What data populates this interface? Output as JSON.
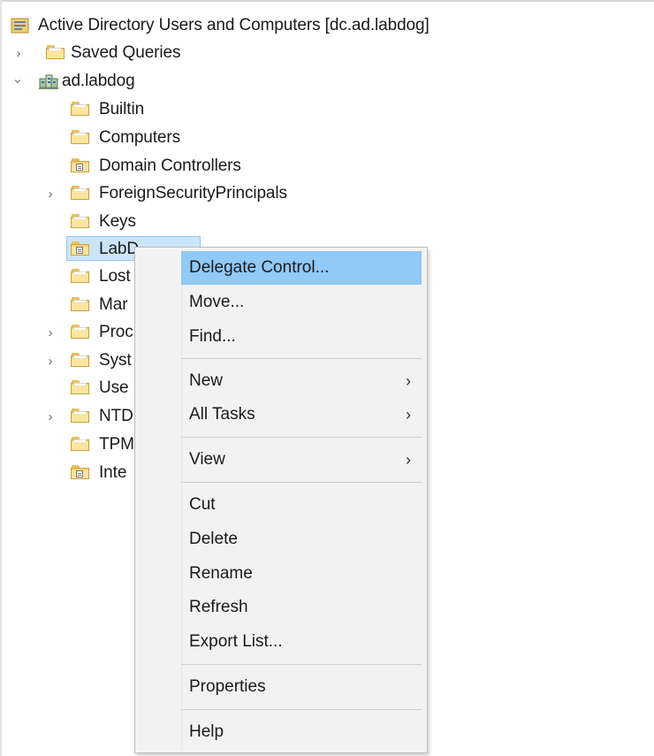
{
  "tree": {
    "root_label": "Active Directory Users and Computers [dc.ad.labdog]",
    "saved_queries_label": "Saved Queries",
    "domain_label": "ad.labdog",
    "items": [
      {
        "label": "Builtin"
      },
      {
        "label": "Computers"
      },
      {
        "label": "Domain Controllers"
      },
      {
        "label": "ForeignSecurityPrincipals"
      },
      {
        "label": "Keys"
      },
      {
        "label": "LabD"
      },
      {
        "label": "Lost"
      },
      {
        "label": "Mar"
      },
      {
        "label": "Proc"
      },
      {
        "label": "Syst"
      },
      {
        "label": "Use"
      },
      {
        "label": "NTD"
      },
      {
        "label": "TPM"
      },
      {
        "label": "Inte"
      }
    ]
  },
  "context_menu": {
    "delegate_control": "Delegate Control...",
    "move": "Move...",
    "find": "Find...",
    "new": "New",
    "all_tasks": "All Tasks",
    "view": "View",
    "cut": "Cut",
    "delete": "Delete",
    "rename": "Rename",
    "refresh": "Refresh",
    "export_list": "Export List...",
    "properties": "Properties",
    "help": "Help"
  },
  "colors": {
    "menu_highlight": "#91c9f7",
    "tree_selection": "#cce4f7",
    "menu_background": "#f2f2f2"
  }
}
